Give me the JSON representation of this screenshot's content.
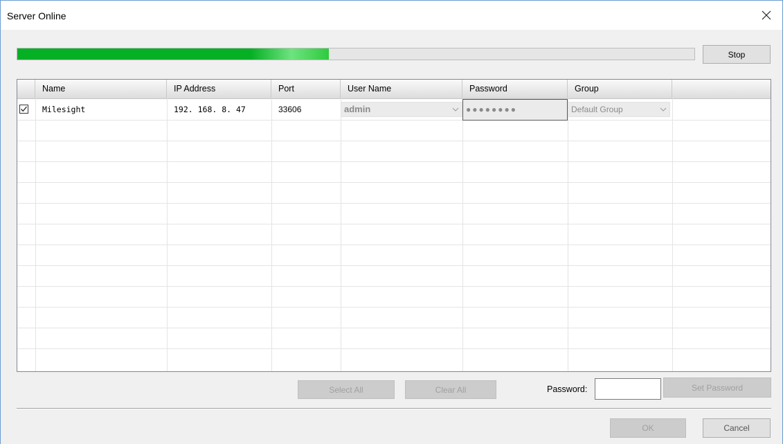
{
  "window": {
    "title": "Server Online",
    "close_glyph": "✕"
  },
  "progress": {
    "percent": 46
  },
  "toolbar": {
    "stop_label": "Stop"
  },
  "table": {
    "columns": [
      "Name",
      "IP Address",
      "Port",
      "User Name",
      "Password",
      "Group"
    ],
    "rows": [
      {
        "checked": true,
        "name": "Milesight",
        "ip": "192. 168. 8. 47",
        "port": "33606",
        "user_name": "admin",
        "password_mask": "●●●●●●●●",
        "group": "Default Group"
      }
    ]
  },
  "actions": {
    "select_all_label": "Select All",
    "clear_all_label": "Clear All",
    "password_label": "Password:",
    "password_value": "",
    "set_password_label": "Set Password"
  },
  "footer": {
    "ok_label": "OK",
    "cancel_label": "Cancel"
  },
  "icons": {
    "close": "close-icon",
    "check": "check-icon",
    "dropdown": "chevron-down-icon"
  },
  "colors": {
    "progress_fill": "#06b025",
    "accent_border": "#6b9bd1"
  }
}
